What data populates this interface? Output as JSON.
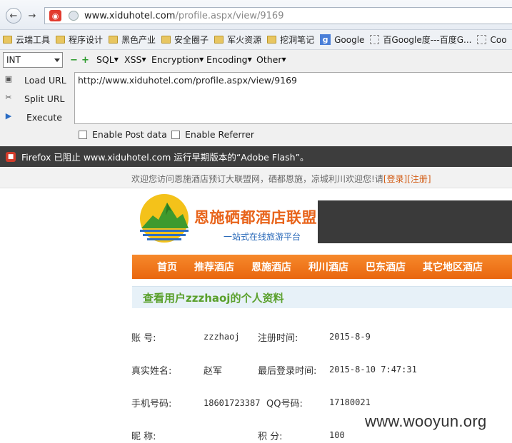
{
  "browser": {
    "url_host": "www.xiduhotel.com",
    "url_path": "/profile.aspx/view/9169",
    "bookmarks": [
      "云端工具",
      "程序设计",
      "黑色产业",
      "安全圈子",
      "军火资源",
      "挖洞笔记",
      "Google",
      "百Google度---百度G...",
      "Coo"
    ]
  },
  "hackbar": {
    "select_value": "INT",
    "menus": [
      "SQL",
      "XSS",
      "Encryption",
      "Encoding",
      "Other"
    ],
    "actions": [
      "Load URL",
      "Split URL",
      "Execute"
    ],
    "url_value": "http://www.xiduhotel.com/profile.aspx/view/9169",
    "enable_post": "Enable Post data",
    "enable_referrer": "Enable Referrer"
  },
  "notification": {
    "text": "Firefox 已阻止 www.xiduhotel.com 运行早期版本的“Adobe Flash”。"
  },
  "site": {
    "welcome": "欢迎您访问恩施酒店预订大联盟网，硒都恩施，凉城利川欢迎您!请",
    "login": "[登录]",
    "register": "[注册]",
    "logo_title": "恩施硒都酒店联盟",
    "logo_subtitle": "一站式在线旅游平台",
    "nav": [
      "首页",
      "推荐酒店",
      "恩施酒店",
      "利川酒店",
      "巴东酒店",
      "其它地区酒店"
    ],
    "profile_heading": "查看用户zzzhaoj的个人资料"
  },
  "profile": {
    "account_label": "账  号:",
    "account_value": "zzzhaoj",
    "reg_time_label": "注册时间:",
    "reg_time_value": "2015-8-9",
    "realname_label": "真实姓名:",
    "realname_value": "赵军",
    "last_login_label": "最后登录时间:",
    "last_login_value": "2015-8-10 7:47:31",
    "mobile_label": "手机号码:",
    "mobile_value": "18601723387",
    "qq_label": "QQ号码:",
    "qq_value": "17180021",
    "nickname_label": "昵  称:",
    "points_label": "积  分:",
    "points_value": "100"
  },
  "watermark": "www.wooyun.org"
}
